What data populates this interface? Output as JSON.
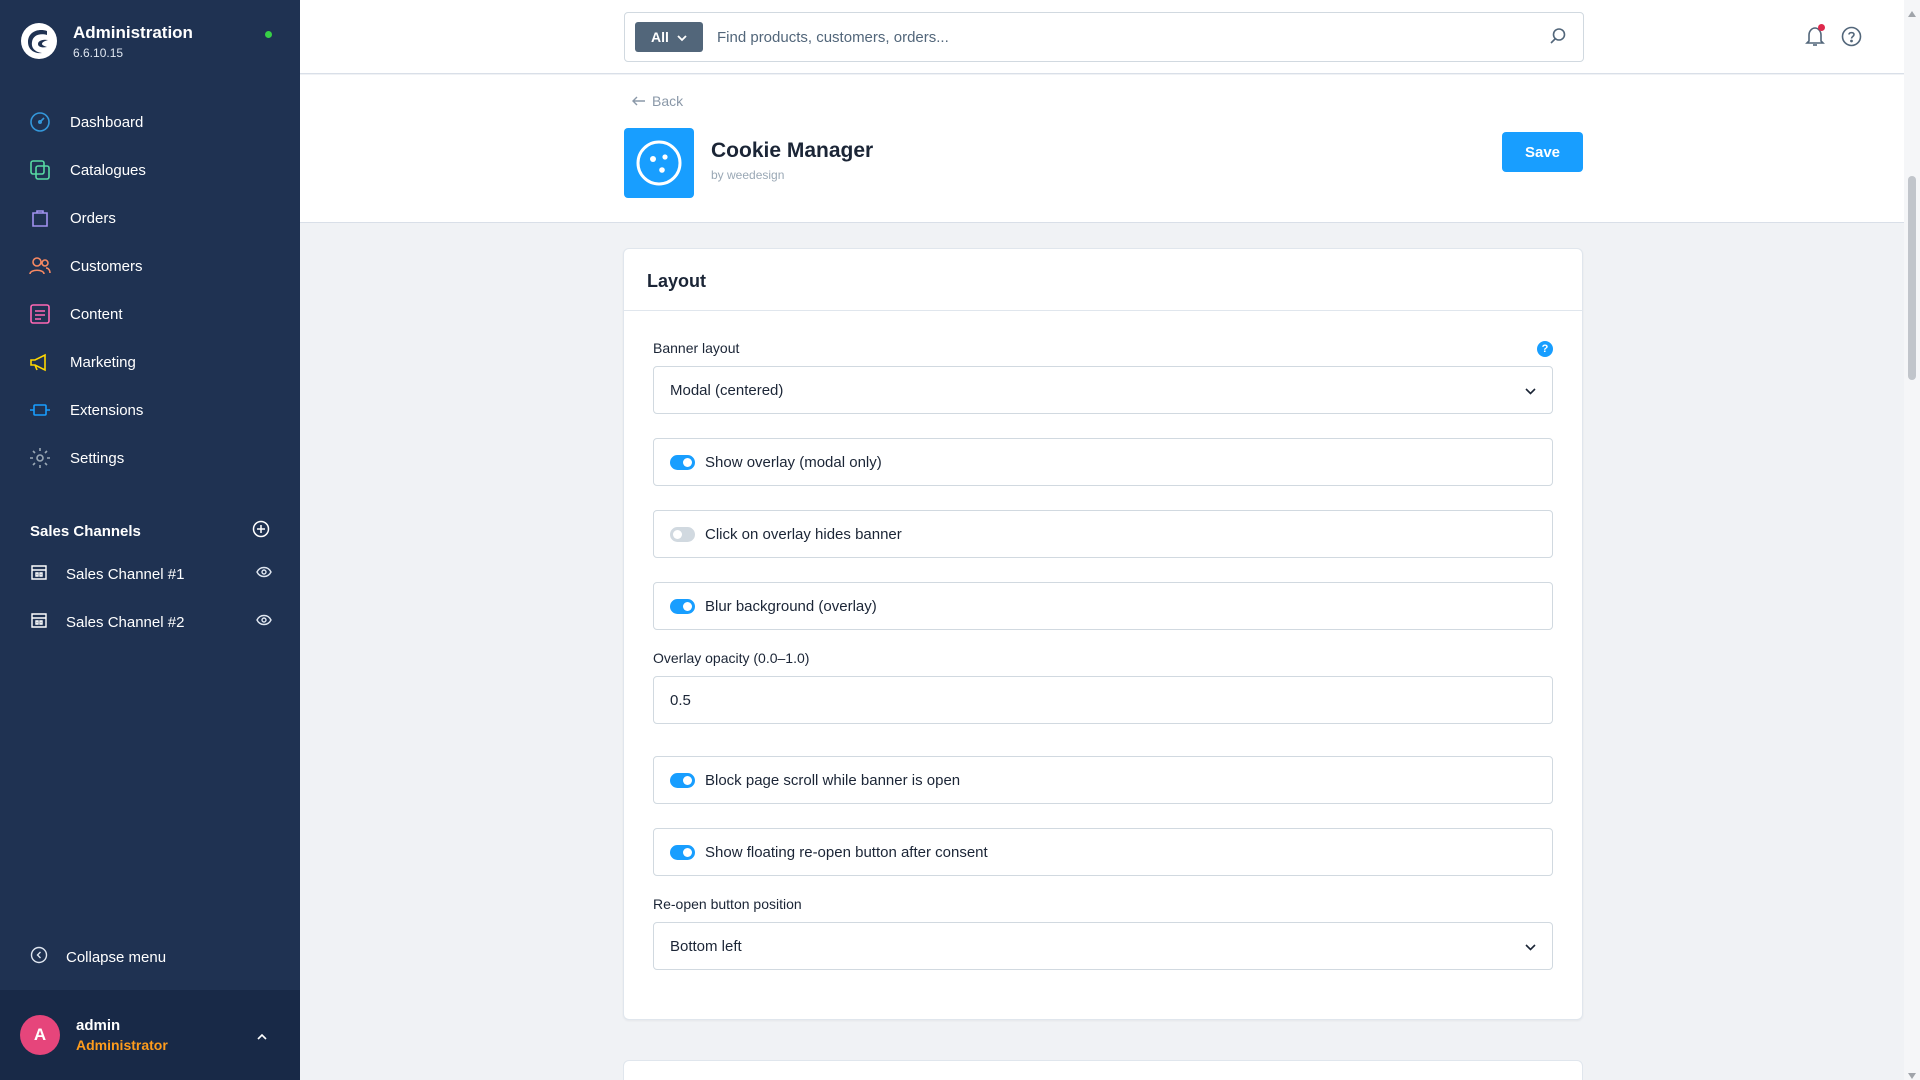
{
  "app": {
    "title": "Administration",
    "version": "6.6.10.15"
  },
  "nav": {
    "items": [
      {
        "label": "Dashboard",
        "icon": "dashboard-icon",
        "color": "#3498db"
      },
      {
        "label": "Catalogues",
        "icon": "catalogue-icon",
        "color": "#57d9a3"
      },
      {
        "label": "Orders",
        "icon": "orders-icon",
        "color": "#a092f0"
      },
      {
        "label": "Customers",
        "icon": "customers-icon",
        "color": "#f88962"
      },
      {
        "label": "Content",
        "icon": "content-icon",
        "color": "#ff68b4"
      },
      {
        "label": "Marketing",
        "icon": "marketing-icon",
        "color": "#ffd700"
      },
      {
        "label": "Extensions",
        "icon": "extensions-icon",
        "color": "#189eff"
      },
      {
        "label": "Settings",
        "icon": "settings-icon",
        "color": "#9aa8b5"
      }
    ]
  },
  "sales_channels": {
    "title": "Sales Channels",
    "items": [
      {
        "label": "Sales Channel #1"
      },
      {
        "label": "Sales Channel #2"
      }
    ]
  },
  "collapse_label": "Collapse menu",
  "user": {
    "initial": "A",
    "name": "admin",
    "role": "Administrator"
  },
  "search": {
    "type_label": "All",
    "placeholder": "Find products, customers, orders..."
  },
  "header": {
    "back_label": "Back",
    "extension_name": "Cookie Manager",
    "extension_by": "by weedesign",
    "save_label": "Save"
  },
  "card": {
    "title": "Layout",
    "banner_layout": {
      "label": "Banner layout",
      "value": "Modal (centered)"
    },
    "toggles": [
      {
        "label": "Show overlay (modal only)",
        "on": true
      },
      {
        "label": "Click on overlay hides banner",
        "on": false
      },
      {
        "label": "Blur background (overlay)",
        "on": true
      }
    ],
    "overlay_opacity": {
      "label": "Overlay opacity (0.0–1.0)",
      "value": "0.5"
    },
    "toggles2": [
      {
        "label": "Block page scroll while banner is open",
        "on": true
      },
      {
        "label": "Show floating re-open button after consent",
        "on": true
      }
    ],
    "reopen_position": {
      "label": "Re-open button position",
      "value": "Bottom left"
    }
  },
  "colors": {
    "sidebar_bg": "#1f3252",
    "accent": "#189eff",
    "user_role": "#ff9c1c",
    "avatar": "#e6457b"
  }
}
